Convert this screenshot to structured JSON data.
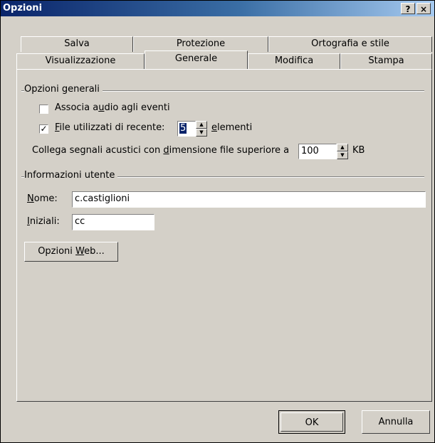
{
  "window": {
    "title": "Opzioni",
    "help_label": "?",
    "close_label": "×"
  },
  "tabs_row1": [
    "Salva",
    "Protezione",
    "Ortografia e stile"
  ],
  "tabs_row2": [
    "Visualizzazione",
    "Generale",
    "Modifica",
    "Stampa"
  ],
  "active_tab": "Generale",
  "general": {
    "section_title": "Opzioni generali",
    "assoc_audio_pre": "Associa a",
    "assoc_audio_key": "u",
    "assoc_audio_post": "dio agli eventi",
    "assoc_audio_checked": false,
    "recent_files_key": "F",
    "recent_files_post": "ile utilizzati di recente:",
    "recent_files_checked": true,
    "recent_files_count": "5",
    "elements_key": "e",
    "elements_post": "lementi",
    "sound_pre": "Collega segnali acustici con ",
    "sound_key": "d",
    "sound_post": "imensione file superiore a",
    "sound_size": "100",
    "sound_unit": "KB"
  },
  "user_info": {
    "section_title": "Informazioni utente",
    "name_key": "N",
    "name_post": "ome:",
    "name_value": "c.castiglioni",
    "initials_key": "I",
    "initials_post": "niziali:",
    "initials_value": "cc"
  },
  "web_options": {
    "pre": "Opzioni ",
    "key": "W",
    "post": "eb..."
  },
  "footer": {
    "ok_label": "OK",
    "cancel_label": "Annulla"
  }
}
